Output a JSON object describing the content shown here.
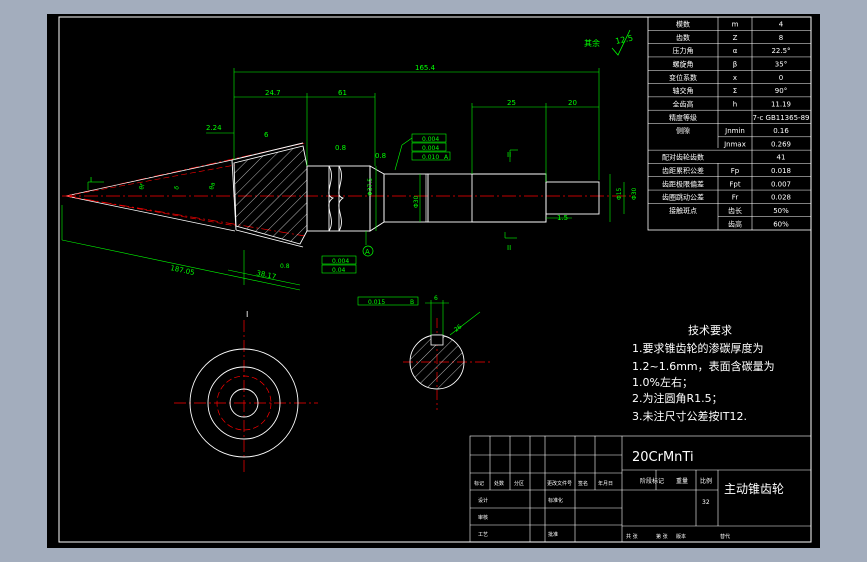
{
  "colors": {
    "background": "#a3adbd",
    "canvas": "#000000",
    "border": "#ffffff",
    "dimension": "#00ff00",
    "outline": "#ffffff",
    "centerline": "#ff0000",
    "annotation": "#00ffff",
    "table_text": "#ffffff"
  },
  "surface_finish": {
    "prefix": "其余",
    "value": "12.5"
  },
  "dimensions": {
    "total_length": "165.4",
    "seg_24_7": "24.7",
    "seg_61": "61",
    "seg_25": "25",
    "seg_20": "20",
    "seg_2_24": "2.24",
    "cone_187_05": "187.05",
    "cone_38_17": "38.17",
    "roughness_a": "6",
    "roughness_b": "0.8",
    "roughness_c": "0.8",
    "roughness_d": "0.8",
    "dia_37": "Φ37.5",
    "dia_30": "Φ30",
    "dia_15": "Φ15",
    "dia_30b": "Φ30",
    "len_1_5": "1.5",
    "section_mark": "II",
    "section_mark_b": "II",
    "view_mark": "I",
    "view_mark_b": "I",
    "datum": "A",
    "tol_1": "0.004",
    "tol_2": "0.004",
    "tol_3": "0.010",
    "tol_3_ref": "A",
    "tol_4": "0.004",
    "tol_5": "0.04",
    "section_tol": "0.015",
    "section_tol_ref": "B",
    "section_w": "6",
    "section_depth": "26",
    "cone_angle_a": "θf",
    "cone_angle_b": "δ",
    "cone_angle_c": "θa"
  },
  "parameter_table": {
    "rows": [
      {
        "name": "模数",
        "symbol": "m",
        "value": "4"
      },
      {
        "name": "齿数",
        "symbol": "Z",
        "value": "8"
      },
      {
        "name": "压力角",
        "symbol": "α",
        "value": "22.5°"
      },
      {
        "name": "螺旋角",
        "symbol": "β",
        "value": "35°"
      },
      {
        "name": "变位系数",
        "symbol": "x",
        "value": "0"
      },
      {
        "name": "轴交角",
        "symbol": "Σ",
        "value": "90°"
      },
      {
        "name": "全齿高",
        "symbol": "h",
        "value": "11.19"
      },
      {
        "name": "精度等级",
        "symbol": "",
        "value": "7-c GB11365-89"
      },
      {
        "name": "侧隙",
        "symbol": "Jnmin",
        "value": "0.16"
      },
      {
        "name": "",
        "symbol": "Jnmax",
        "value": "0.269"
      },
      {
        "name": "配对齿轮齿数",
        "symbol": "",
        "value": "41"
      },
      {
        "name": "齿距累积公差",
        "symbol": "Fp",
        "value": "0.018"
      },
      {
        "name": "齿距极限偏差",
        "symbol": "Fpt",
        "value": "0.007"
      },
      {
        "name": "齿圈跳动公差",
        "symbol": "Fr",
        "value": "0.028"
      },
      {
        "name": "接触斑点",
        "symbol": "齿长",
        "value": "50%"
      },
      {
        "name": "",
        "symbol": "齿高",
        "value": "60%"
      }
    ]
  },
  "tech_requirements": {
    "title": "技术要求",
    "lines": [
      "1.要求锥齿轮的渗碳厚度为",
      "1.2~1.6mm，表面含碳量为",
      "1.0%左右；",
      "2.为注圆角R1.5；",
      "3.未注尺寸公差按IT12."
    ]
  },
  "title_block": {
    "material": "20CrMnTi",
    "part_name": "主动锥齿轮",
    "scale_label": "比例",
    "weight_label": "重量",
    "scale_value": "32",
    "stage_label": "阶段标记",
    "labels": [
      "标记",
      "处数",
      "分区",
      "更改文件号",
      "签名",
      "年月日"
    ],
    "rows": [
      "设计",
      "审核",
      "工艺"
    ],
    "row_labels_b": [
      "标准化",
      "批准"
    ],
    "bottom": [
      "共 张",
      "第 张",
      "版本",
      "替代"
    ]
  }
}
